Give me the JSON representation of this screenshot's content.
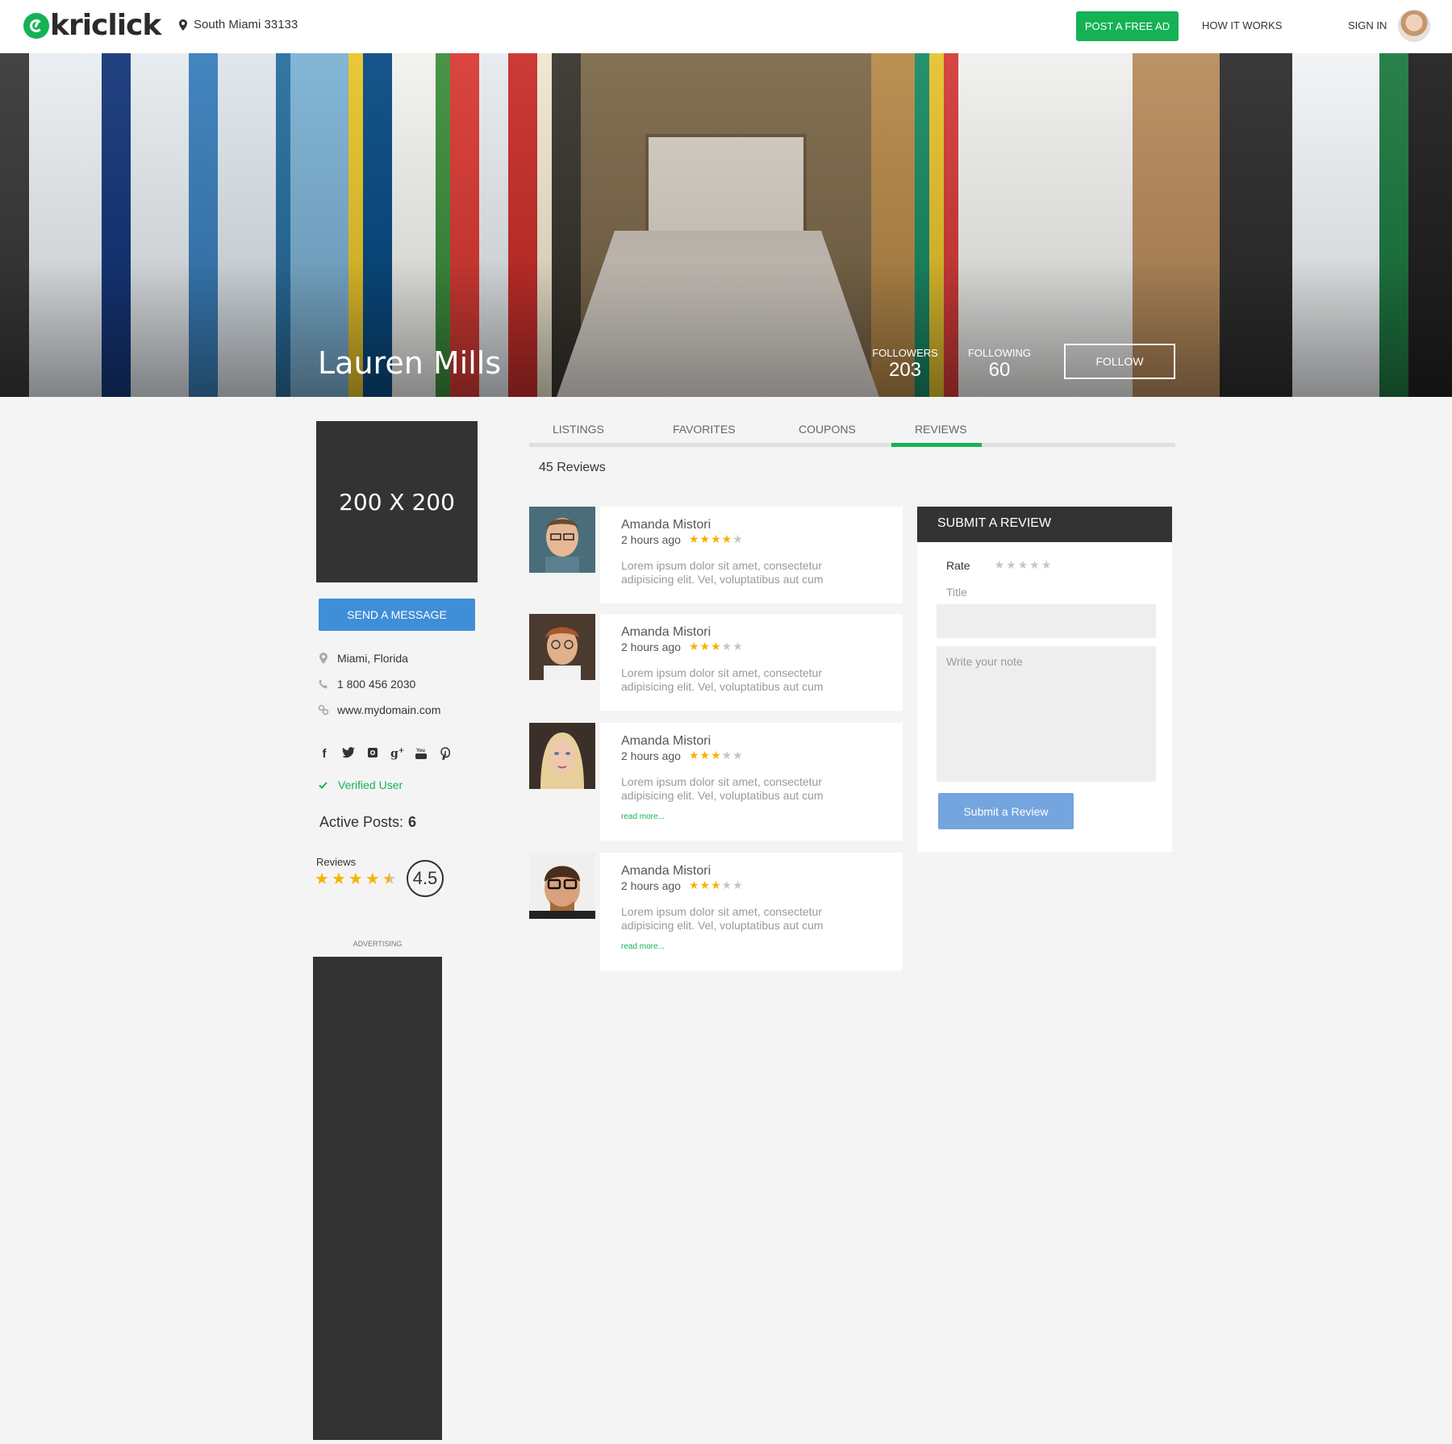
{
  "header": {
    "brand": "kriclick",
    "location": "South Miami 33133",
    "post_ad": "POST A FREE AD",
    "how_it_works": "HOW IT WORKS",
    "sign_in": "SIGN IN"
  },
  "hero": {
    "name": "Lauren Mills",
    "followers_label": "FOLLOWERS",
    "followers_value": "203",
    "following_label": "FOLLOWING",
    "following_value": "60",
    "follow_button": "FOLLOW"
  },
  "profile": {
    "photo_placeholder": "200 X 200",
    "send_message": "SEND A MESSAGE",
    "location": "Miami, Florida",
    "phone": "1 800 456 2030",
    "website": "www.mydomain.com",
    "social_icons": [
      "facebook-icon",
      "twitter-icon",
      "instagram-icon",
      "google-plus-icon",
      "youtube-icon",
      "pinterest-icon"
    ],
    "verified": "Verified User",
    "active_posts_label": "Active Posts:",
    "active_posts_value": "6",
    "reviews_label": "Reviews",
    "rating": 4.5,
    "rating_text": "4.5",
    "advertising": "ADVERTISING"
  },
  "tabs": [
    {
      "label": "LISTINGS",
      "active": false
    },
    {
      "label": "FAVORITES",
      "active": false
    },
    {
      "label": "COUPONS",
      "active": false
    },
    {
      "label": "REVIEWS",
      "active": true
    }
  ],
  "reviews_count": "45 Reviews",
  "reviews": [
    {
      "name": "Amanda Mistori",
      "time": "2 hours ago",
      "stars": 4,
      "text": "Lorem ipsum dolor sit amet, consectetur adipisicing elit. Vel, voluptatibus aut cum",
      "read_more": ""
    },
    {
      "name": "Amanda Mistori",
      "time": "2 hours ago",
      "stars": 3,
      "text": "Lorem ipsum dolor sit amet, consectetur adipisicing elit. Vel, voluptatibus aut cum",
      "read_more": ""
    },
    {
      "name": "Amanda Mistori",
      "time": "2 hours ago",
      "stars": 3,
      "text": "Lorem ipsum dolor sit amet, consectetur adipisicing elit. Vel, voluptatibus aut cum",
      "read_more": "read more..."
    },
    {
      "name": "Amanda Mistori",
      "time": "2 hours ago",
      "stars": 3,
      "text": "Lorem ipsum dolor sit amet, consectetur adipisicing elit. Vel, voluptatibus aut cum",
      "read_more": "read more..."
    }
  ],
  "submit": {
    "heading": "SUBMIT A REVIEW",
    "rate_label": "Rate",
    "title_label": "Title",
    "note_placeholder": "Write your note",
    "button": "Submit a Review"
  },
  "colors": {
    "accent": "#14b255",
    "message_button": "#3f8ed8",
    "submit_button": "#74a5de",
    "dark": "#333333",
    "star": "#f7b300"
  }
}
